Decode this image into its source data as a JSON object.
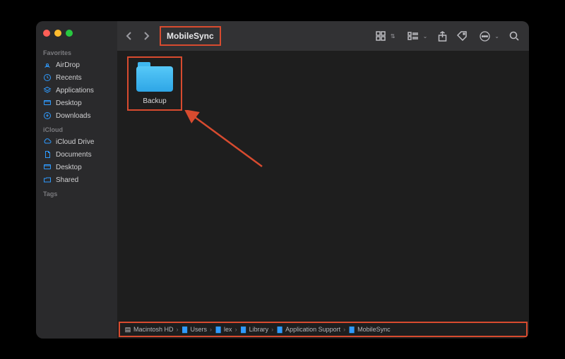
{
  "window": {
    "title": "MobileSync"
  },
  "sidebar": {
    "sections": [
      {
        "title": "Favorites",
        "items": [
          {
            "icon": "airdrop",
            "label": "AirDrop"
          },
          {
            "icon": "recents",
            "label": "Recents"
          },
          {
            "icon": "applications",
            "label": "Applications"
          },
          {
            "icon": "desktop",
            "label": "Desktop"
          },
          {
            "icon": "downloads",
            "label": "Downloads"
          }
        ]
      },
      {
        "title": "iCloud",
        "items": [
          {
            "icon": "icloud",
            "label": "iCloud Drive"
          },
          {
            "icon": "documents",
            "label": "Documents"
          },
          {
            "icon": "desktop",
            "label": "Desktop"
          },
          {
            "icon": "shared",
            "label": "Shared"
          }
        ]
      },
      {
        "title": "Tags",
        "items": []
      }
    ]
  },
  "content": {
    "items": [
      {
        "name": "Backup",
        "kind": "folder"
      }
    ]
  },
  "pathbar": {
    "segments": [
      {
        "icon": "disk",
        "label": "Macintosh HD"
      },
      {
        "icon": "folder",
        "label": "Users"
      },
      {
        "icon": "folder",
        "label": "lex"
      },
      {
        "icon": "folder",
        "label": "Library"
      },
      {
        "icon": "folder",
        "label": "Application Support"
      },
      {
        "icon": "folder",
        "label": "MobileSync"
      }
    ]
  },
  "annotation": {
    "color": "#d84b2f"
  }
}
